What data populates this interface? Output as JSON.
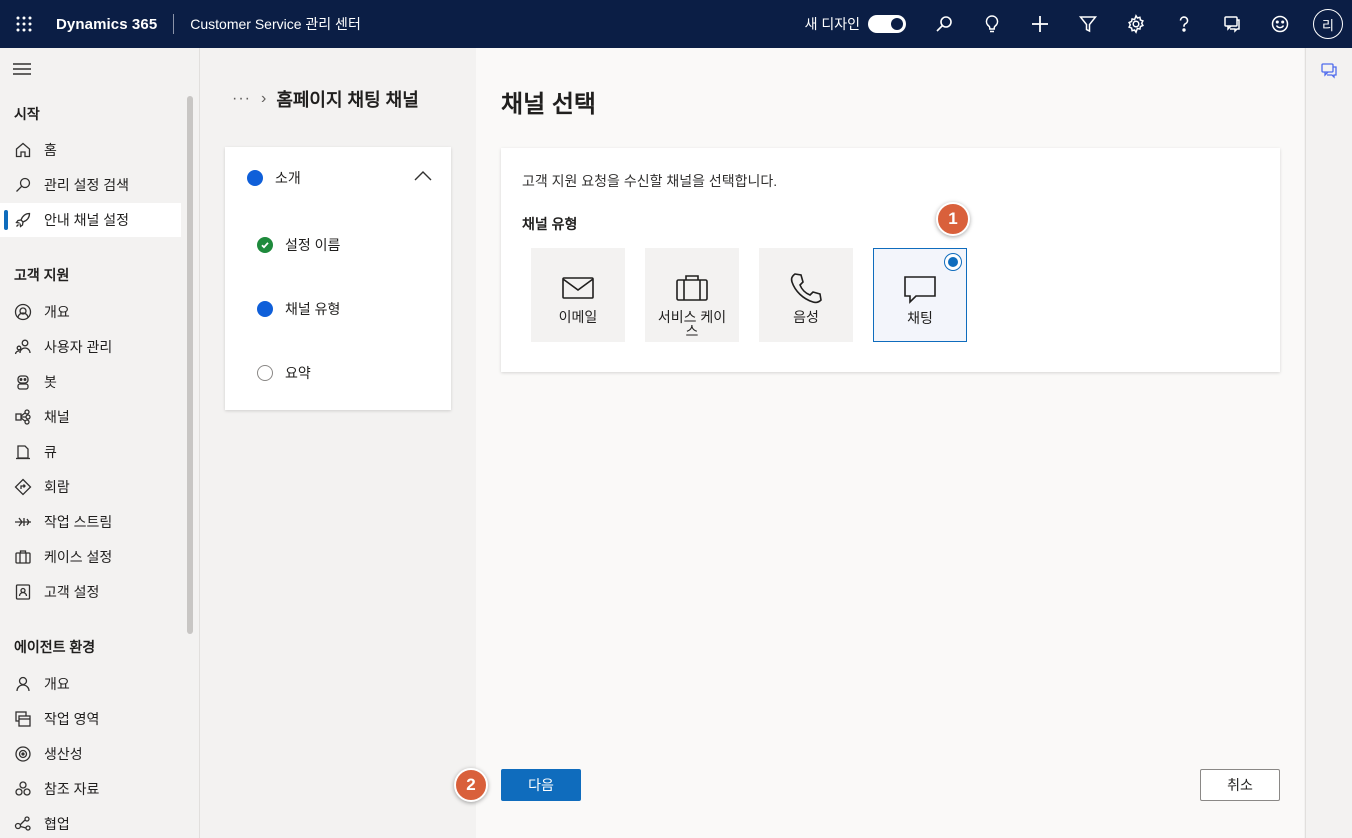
{
  "topbar": {
    "brand": "Dynamics 365",
    "app_title": "Customer Service 관리 센터",
    "new_design_label": "새 디자인",
    "avatar_initial": "리"
  },
  "nav": {
    "groups": {
      "start": "시작",
      "customer_support": "고객 지원",
      "agent_env": "에이전트 환경"
    },
    "items": {
      "home": "홈",
      "search_admin": "관리 설정 검색",
      "guided_channel": "안내 채널 설정",
      "cs_overview": "개요",
      "user_mgmt": "사용자 관리",
      "bots": "봇",
      "channels": "채널",
      "queues": "큐",
      "routing": "회람",
      "workstreams": "작업 스트림",
      "case_settings": "케이스 설정",
      "customer_settings": "고객 설정",
      "agent_overview": "개요",
      "workspaces": "작업 영역",
      "productivity": "생산성",
      "knowledge": "참조 자료",
      "collaboration": "협업"
    }
  },
  "wizard": {
    "breadcrumb_dots": "···",
    "title": "홈페이지 채팅 채널",
    "steps": {
      "intro": "소개",
      "setup_name": "설정 이름",
      "channel_type": "채널 유형",
      "summary": "요약"
    }
  },
  "main": {
    "page_title": "채널 선택",
    "description": "고객 지원 요청을 수신할 채널을 선택합니다.",
    "section_label": "채널 유형",
    "tiles": {
      "email": "이메일",
      "service_case": "서비스 케이스",
      "voice": "음성",
      "chat": "채팅"
    },
    "selected_channel": "채팅",
    "next_button": "다음",
    "cancel_button": "취소"
  },
  "annotations": {
    "marker1": "1",
    "marker2": "2"
  },
  "colors": {
    "topbar": "#0b1e45",
    "accent": "#0f6cbd",
    "marker": "#d9603b",
    "step_complete": "#1e8a3c",
    "step_current": "#0f5fd9"
  }
}
